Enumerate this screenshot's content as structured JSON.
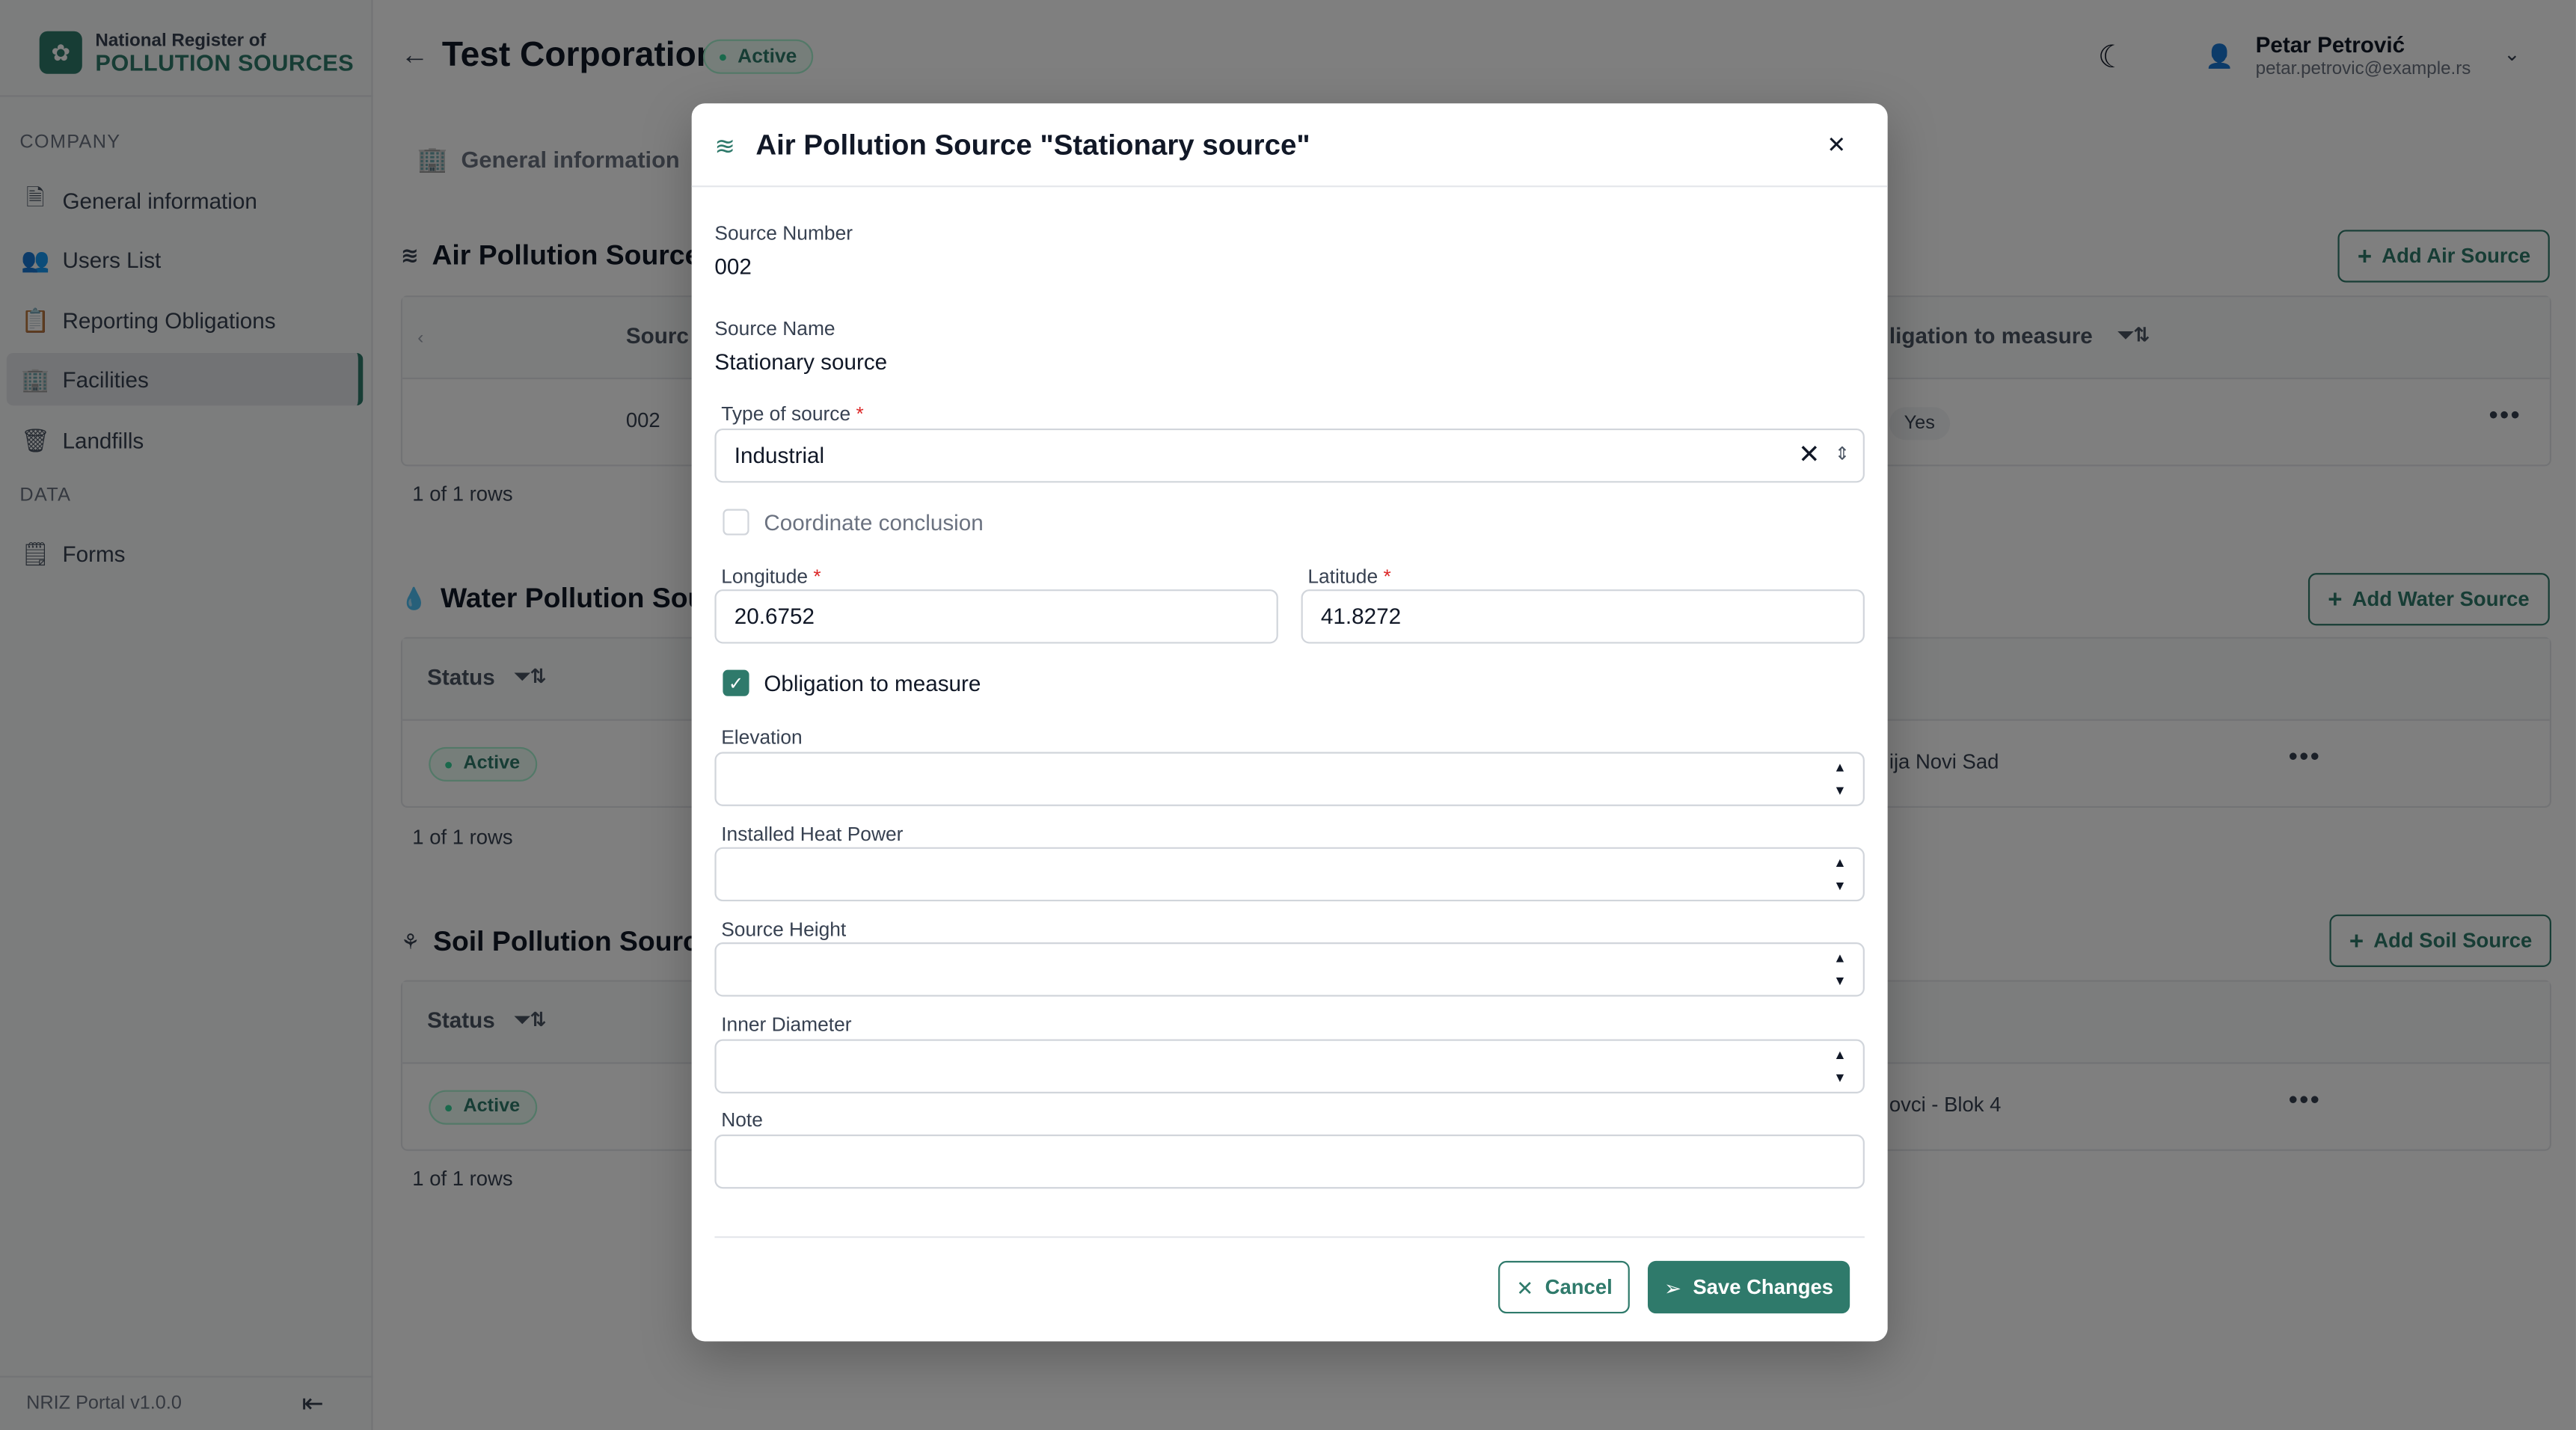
{
  "brand": {
    "top": "National Register of",
    "bottom": "POLLUTION SOURCES"
  },
  "sidebar": {
    "company_label": "COMPANY",
    "data_label": "DATA",
    "items": [
      {
        "label": "General information",
        "icon": "document-icon"
      },
      {
        "label": "Users List",
        "icon": "users-icon"
      },
      {
        "label": "Reporting Obligations",
        "icon": "clipboard-icon"
      },
      {
        "label": "Facilities",
        "icon": "building-icon"
      },
      {
        "label": "Landfills",
        "icon": "trash-icon"
      }
    ],
    "data_items": [
      {
        "label": "Forms",
        "icon": "form-icon"
      }
    ],
    "version": "NRIZ Portal v1.0.0"
  },
  "header": {
    "title": "Test Corporation",
    "badge": "Active",
    "user_name": "Petar Petrović",
    "user_email": "petar.petrovic@example.rs"
  },
  "tabs": {
    "general": "General information"
  },
  "air": {
    "title": "Air Pollution Source",
    "add_label": "Add Air Source",
    "col_source": "Sourc",
    "col_obligation": "ligation to measure",
    "row_number": "002",
    "row_obligation": "Yes",
    "rows_count": "1 of 1 rows"
  },
  "water": {
    "title": "Water Pollution Sou",
    "add_label": "Add Water Source",
    "col_status": "Status",
    "row_status": "Active",
    "row_name": "ija Novi Sad",
    "rows_count": "1 of 1 rows"
  },
  "soil": {
    "title": "Soil Pollution Sourc",
    "add_label": "Add Soil Source",
    "col_status": "Status",
    "row_status": "Active",
    "row_name": "ovci - Blok 4",
    "rows_count": "1 of 1 rows"
  },
  "modal": {
    "title": "Air Pollution Source \"Stationary source\"",
    "source_number_label": "Source Number",
    "source_number": "002",
    "source_name_label": "Source Name",
    "source_name": "Stationary source",
    "type_label": "Type of source",
    "type_value": "Industrial",
    "coord_conclusion_label": "Coordinate conclusion",
    "coord_conclusion_checked": false,
    "longitude_label": "Longitude",
    "longitude": "20.6752",
    "latitude_label": "Latitude",
    "latitude": "41.8272",
    "obligation_label": "Obligation to measure",
    "obligation_checked": true,
    "elevation_label": "Elevation",
    "elevation": "",
    "heat_power_label": "Installed Heat Power",
    "heat_power": "",
    "source_height_label": "Source Height",
    "source_height": "",
    "inner_diameter_label": "Inner Diameter",
    "inner_diameter": "",
    "note_label": "Note",
    "note": "",
    "cancel_label": "Cancel",
    "save_label": "Save Changes"
  },
  "colors": {
    "accent": "#2f7a6b",
    "required": "#dc2626",
    "overlay": "rgba(0,0,0,0.5)"
  }
}
